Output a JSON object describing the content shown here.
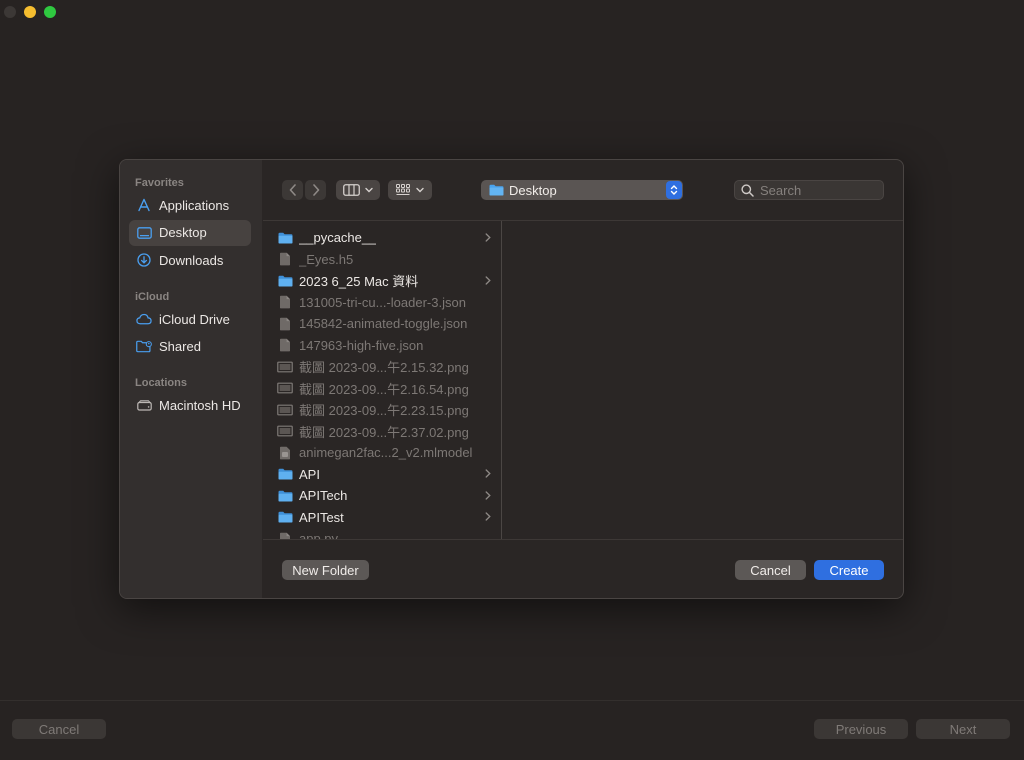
{
  "window": {
    "bottom_buttons": {
      "cancel": "Cancel",
      "previous": "Previous",
      "next": "Next"
    }
  },
  "dialog": {
    "sidebar": {
      "sections": [
        {
          "title": "Favorites",
          "items": [
            {
              "label": "Applications",
              "icon": "applications-icon",
              "selected": false
            },
            {
              "label": "Desktop",
              "icon": "desktop-icon",
              "selected": true
            },
            {
              "label": "Downloads",
              "icon": "downloads-icon",
              "selected": false
            }
          ]
        },
        {
          "title": "iCloud",
          "items": [
            {
              "label": "iCloud Drive",
              "icon": "cloud-icon",
              "selected": false
            },
            {
              "label": "Shared",
              "icon": "shared-folder-icon",
              "selected": false
            }
          ]
        },
        {
          "title": "Locations",
          "items": [
            {
              "label": "Macintosh HD",
              "icon": "drive-icon",
              "selected": false
            }
          ]
        }
      ]
    },
    "toolbar": {
      "location": "Desktop",
      "search_placeholder": "Search"
    },
    "files": [
      {
        "name": "__pycache__",
        "type": "folder",
        "enabled": true,
        "has_children": true
      },
      {
        "name": "_Eyes.h5",
        "type": "document",
        "enabled": false,
        "has_children": false
      },
      {
        "name": "2023 6_25 Mac 資料",
        "type": "folder",
        "enabled": true,
        "has_children": true
      },
      {
        "name": "131005-tri-cu...-loader-3.json",
        "type": "document",
        "enabled": false,
        "has_children": false
      },
      {
        "name": "145842-animated-toggle.json",
        "type": "document",
        "enabled": false,
        "has_children": false
      },
      {
        "name": "147963-high-five.json",
        "type": "document",
        "enabled": false,
        "has_children": false
      },
      {
        "name": "截圖 2023-09...午2.15.32.png",
        "type": "image",
        "enabled": false,
        "has_children": false
      },
      {
        "name": "截圖 2023-09...午2.16.54.png",
        "type": "image",
        "enabled": false,
        "has_children": false
      },
      {
        "name": "截圖 2023-09...午2.23.15.png",
        "type": "image",
        "enabled": false,
        "has_children": false
      },
      {
        "name": "截圖 2023-09...午2.37.02.png",
        "type": "image",
        "enabled": false,
        "has_children": false
      },
      {
        "name": "animegan2fac...2_v2.mlmodel",
        "type": "model",
        "enabled": false,
        "has_children": false
      },
      {
        "name": "API",
        "type": "folder",
        "enabled": true,
        "has_children": true
      },
      {
        "name": "APITech",
        "type": "folder",
        "enabled": true,
        "has_children": true
      },
      {
        "name": "APITest",
        "type": "folder",
        "enabled": true,
        "has_children": true
      },
      {
        "name": "app.py",
        "type": "document",
        "enabled": false,
        "has_children": false
      }
    ],
    "footer": {
      "new_folder": "New Folder",
      "cancel": "Cancel",
      "create": "Create"
    },
    "colors": {
      "accent": "#2f6fe0",
      "folder": "#4aa4ee"
    }
  }
}
